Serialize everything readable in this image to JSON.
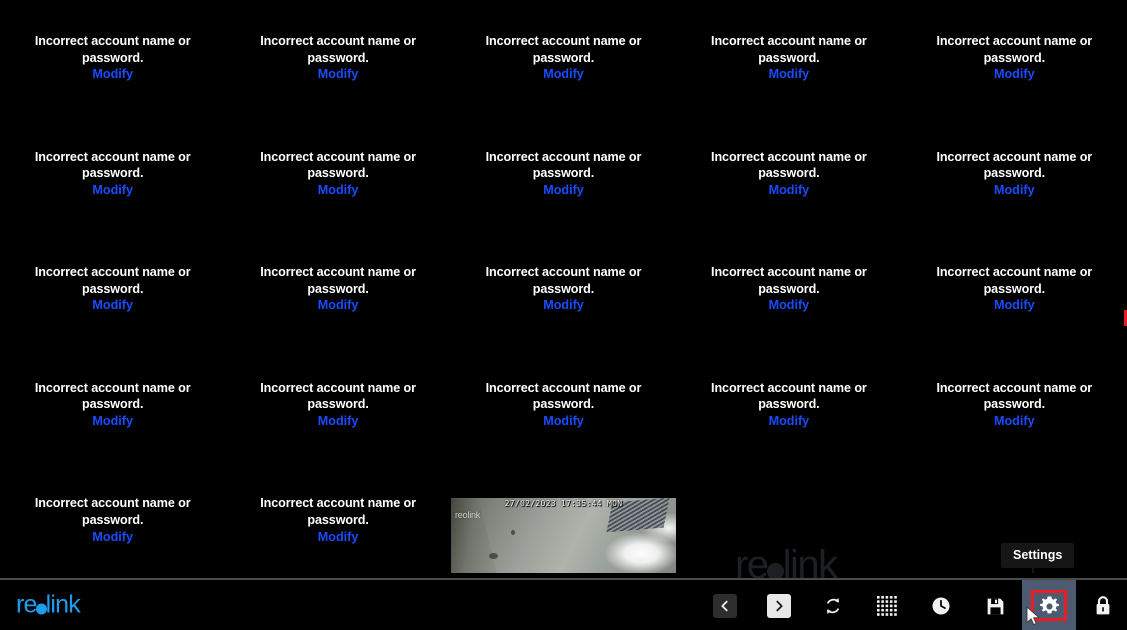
{
  "app": {
    "brand": "reolink",
    "background_watermark": "reolink",
    "background_color": "#000000",
    "accent_color": "#1f9cf0",
    "link_color": "#1a4cff",
    "highlight_color": "#ec1c24",
    "active_tool_bg": "#4c5a72"
  },
  "grid": {
    "columns": 5,
    "rows": 5,
    "cells": [
      {
        "id": "cell-1",
        "type": "error",
        "message": "Incorrect account name or password.",
        "action": "Modify"
      },
      {
        "id": "cell-2",
        "type": "error",
        "message": "Incorrect account name or password.",
        "action": "Modify"
      },
      {
        "id": "cell-3",
        "type": "error",
        "message": "Incorrect account name or password.",
        "action": "Modify"
      },
      {
        "id": "cell-4",
        "type": "error",
        "message": "Incorrect account name or password.",
        "action": "Modify"
      },
      {
        "id": "cell-5",
        "type": "error",
        "message": "Incorrect account name or password.",
        "action": "Modify"
      },
      {
        "id": "cell-6",
        "type": "error",
        "message": "Incorrect account name or password.",
        "action": "Modify"
      },
      {
        "id": "cell-7",
        "type": "error",
        "message": "Incorrect account name or password.",
        "action": "Modify"
      },
      {
        "id": "cell-8",
        "type": "error",
        "message": "Incorrect account name or password.",
        "action": "Modify"
      },
      {
        "id": "cell-9",
        "type": "error",
        "message": "Incorrect account name or password.",
        "action": "Modify"
      },
      {
        "id": "cell-10",
        "type": "error",
        "message": "Incorrect account name or password.",
        "action": "Modify"
      },
      {
        "id": "cell-11",
        "type": "error",
        "message": "Incorrect account name or password.",
        "action": "Modify"
      },
      {
        "id": "cell-12",
        "type": "error",
        "message": "Incorrect account name or password.",
        "action": "Modify"
      },
      {
        "id": "cell-13",
        "type": "error",
        "message": "Incorrect account name or password.",
        "action": "Modify"
      },
      {
        "id": "cell-14",
        "type": "error",
        "message": "Incorrect account name or password.",
        "action": "Modify"
      },
      {
        "id": "cell-15",
        "type": "error",
        "message": "Incorrect account name or password.",
        "action": "Modify"
      },
      {
        "id": "cell-16",
        "type": "error",
        "message": "Incorrect account name or password.",
        "action": "Modify"
      },
      {
        "id": "cell-17",
        "type": "error",
        "message": "Incorrect account name or password.",
        "action": "Modify"
      },
      {
        "id": "cell-18",
        "type": "error",
        "message": "Incorrect account name or password.",
        "action": "Modify"
      },
      {
        "id": "cell-19",
        "type": "error",
        "message": "Incorrect account name or password.",
        "action": "Modify"
      },
      {
        "id": "cell-20",
        "type": "error",
        "message": "Incorrect account name or password.",
        "action": "Modify"
      },
      {
        "id": "cell-21",
        "type": "error",
        "message": "Incorrect account name or password.",
        "action": "Modify"
      },
      {
        "id": "cell-22",
        "type": "error",
        "message": "Incorrect account name or password.",
        "action": "Modify"
      },
      {
        "id": "cell-23",
        "type": "video",
        "timestamp": "27/02/2023 17:35:44 MON",
        "watermark": "reolink"
      },
      {
        "id": "cell-24",
        "type": "empty"
      },
      {
        "id": "cell-25",
        "type": "empty"
      }
    ]
  },
  "toolbar": {
    "tools": [
      {
        "id": "previous-page",
        "icon": "chevron-left-icon",
        "label": "Previous page",
        "state": "disabled"
      },
      {
        "id": "next-page",
        "icon": "chevron-right-icon",
        "label": "Next page",
        "state": "enabled"
      },
      {
        "id": "auto-cycle",
        "icon": "refresh-cycle-icon",
        "label": "Auto Cycle",
        "state": "enabled"
      },
      {
        "id": "layout",
        "icon": "grid-layout-icon",
        "label": "Layout",
        "state": "enabled"
      },
      {
        "id": "playback",
        "icon": "clock-icon",
        "label": "Playback",
        "state": "enabled"
      },
      {
        "id": "save",
        "icon": "floppy-disk-icon",
        "label": "Save",
        "state": "enabled"
      },
      {
        "id": "settings",
        "icon": "gear-icon",
        "label": "Settings",
        "state": "selected"
      },
      {
        "id": "lock",
        "icon": "lock-icon",
        "label": "Lock",
        "state": "enabled"
      }
    ],
    "tooltip": "Settings"
  }
}
